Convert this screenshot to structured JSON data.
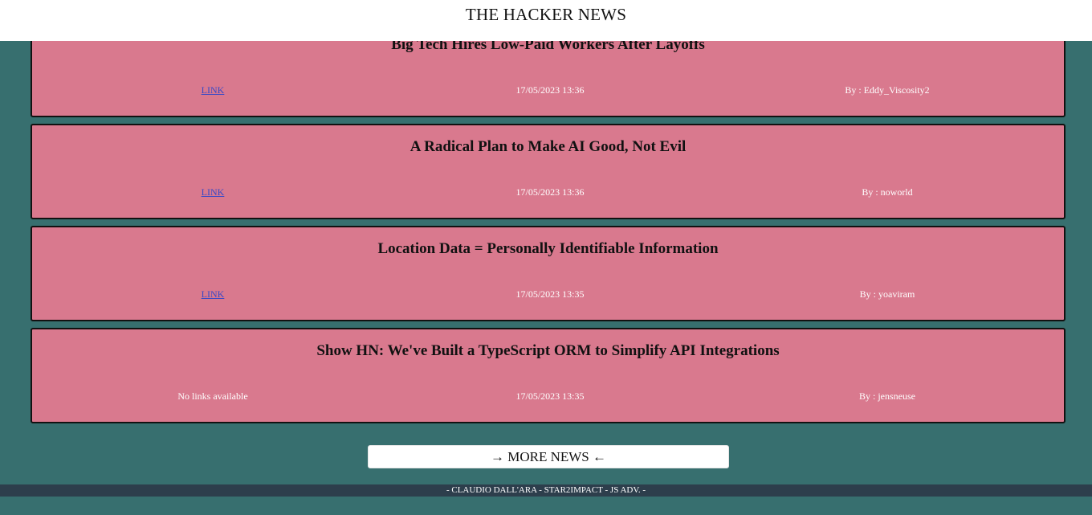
{
  "header": {
    "title": "THE HACKER NEWS"
  },
  "news": [
    {
      "title": "Big Tech Hires Low-Paid Workers After Layoffs",
      "link_label": "LINK",
      "date": "17/05/2023 13:36",
      "author": "By : Eddy_Viscosity2"
    },
    {
      "title": "A Radical Plan to Make AI Good, Not Evil",
      "link_label": "LINK",
      "date": "17/05/2023 13:36",
      "author": "By : noworld"
    },
    {
      "title": "Location Data = Personally Identifiable Information",
      "link_label": "LINK",
      "date": "17/05/2023 13:35",
      "author": "By : yoaviram"
    },
    {
      "title": "Show HN: We've Built a TypeScript ORM to Simplify API Integrations",
      "no_link_label": "No links available",
      "date": "17/05/2023 13:35",
      "author": "By : jensneuse"
    }
  ],
  "more_button": {
    "label": "→ MORE NEWS ←"
  },
  "footer": {
    "text": "- CLAUDIO DALL'ARA - STAR2IMPACT - JS ADV. -"
  },
  "colors": {
    "background": "#376f6f",
    "card": "#d9798e",
    "footer": "#2d3e4c",
    "link": "#3a49c6"
  }
}
